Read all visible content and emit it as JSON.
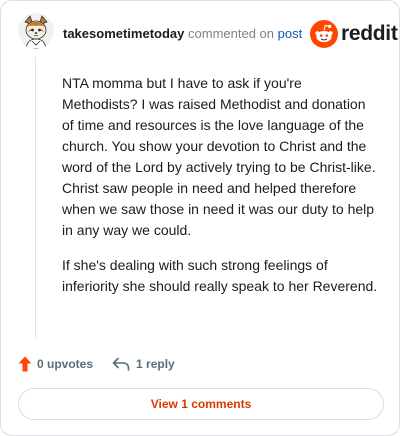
{
  "header": {
    "username": "takesometimetoday",
    "commented_on": "commented on",
    "post_link": "post"
  },
  "brand": {
    "logo_icon": "reddit-snoo-icon",
    "wordmark": "reddit",
    "accent_color": "#ff4500"
  },
  "comment": {
    "paragraphs": [
      "NTA momma but I have to ask if you're Methodists? I was raised Methodist and donation of time and resources is the love language of the church. You show your devotion to Christ and the word of the Lord by actively trying to be Christ-like. Christ saw people in need and helped therefore when we saw those in need it was our duty to help in any way we could.",
      "If she's dealing with such strong feelings of inferiority she should really speak to her Reverend."
    ]
  },
  "actions": {
    "upvote_icon": "upvote-arrow-icon",
    "upvotes_label": "0 upvotes",
    "reply_icon": "reply-arrow-icon",
    "reply_label": "1 reply"
  },
  "footer": {
    "view_comments_label": "View 1 comments",
    "link_color": "#d93a00"
  }
}
